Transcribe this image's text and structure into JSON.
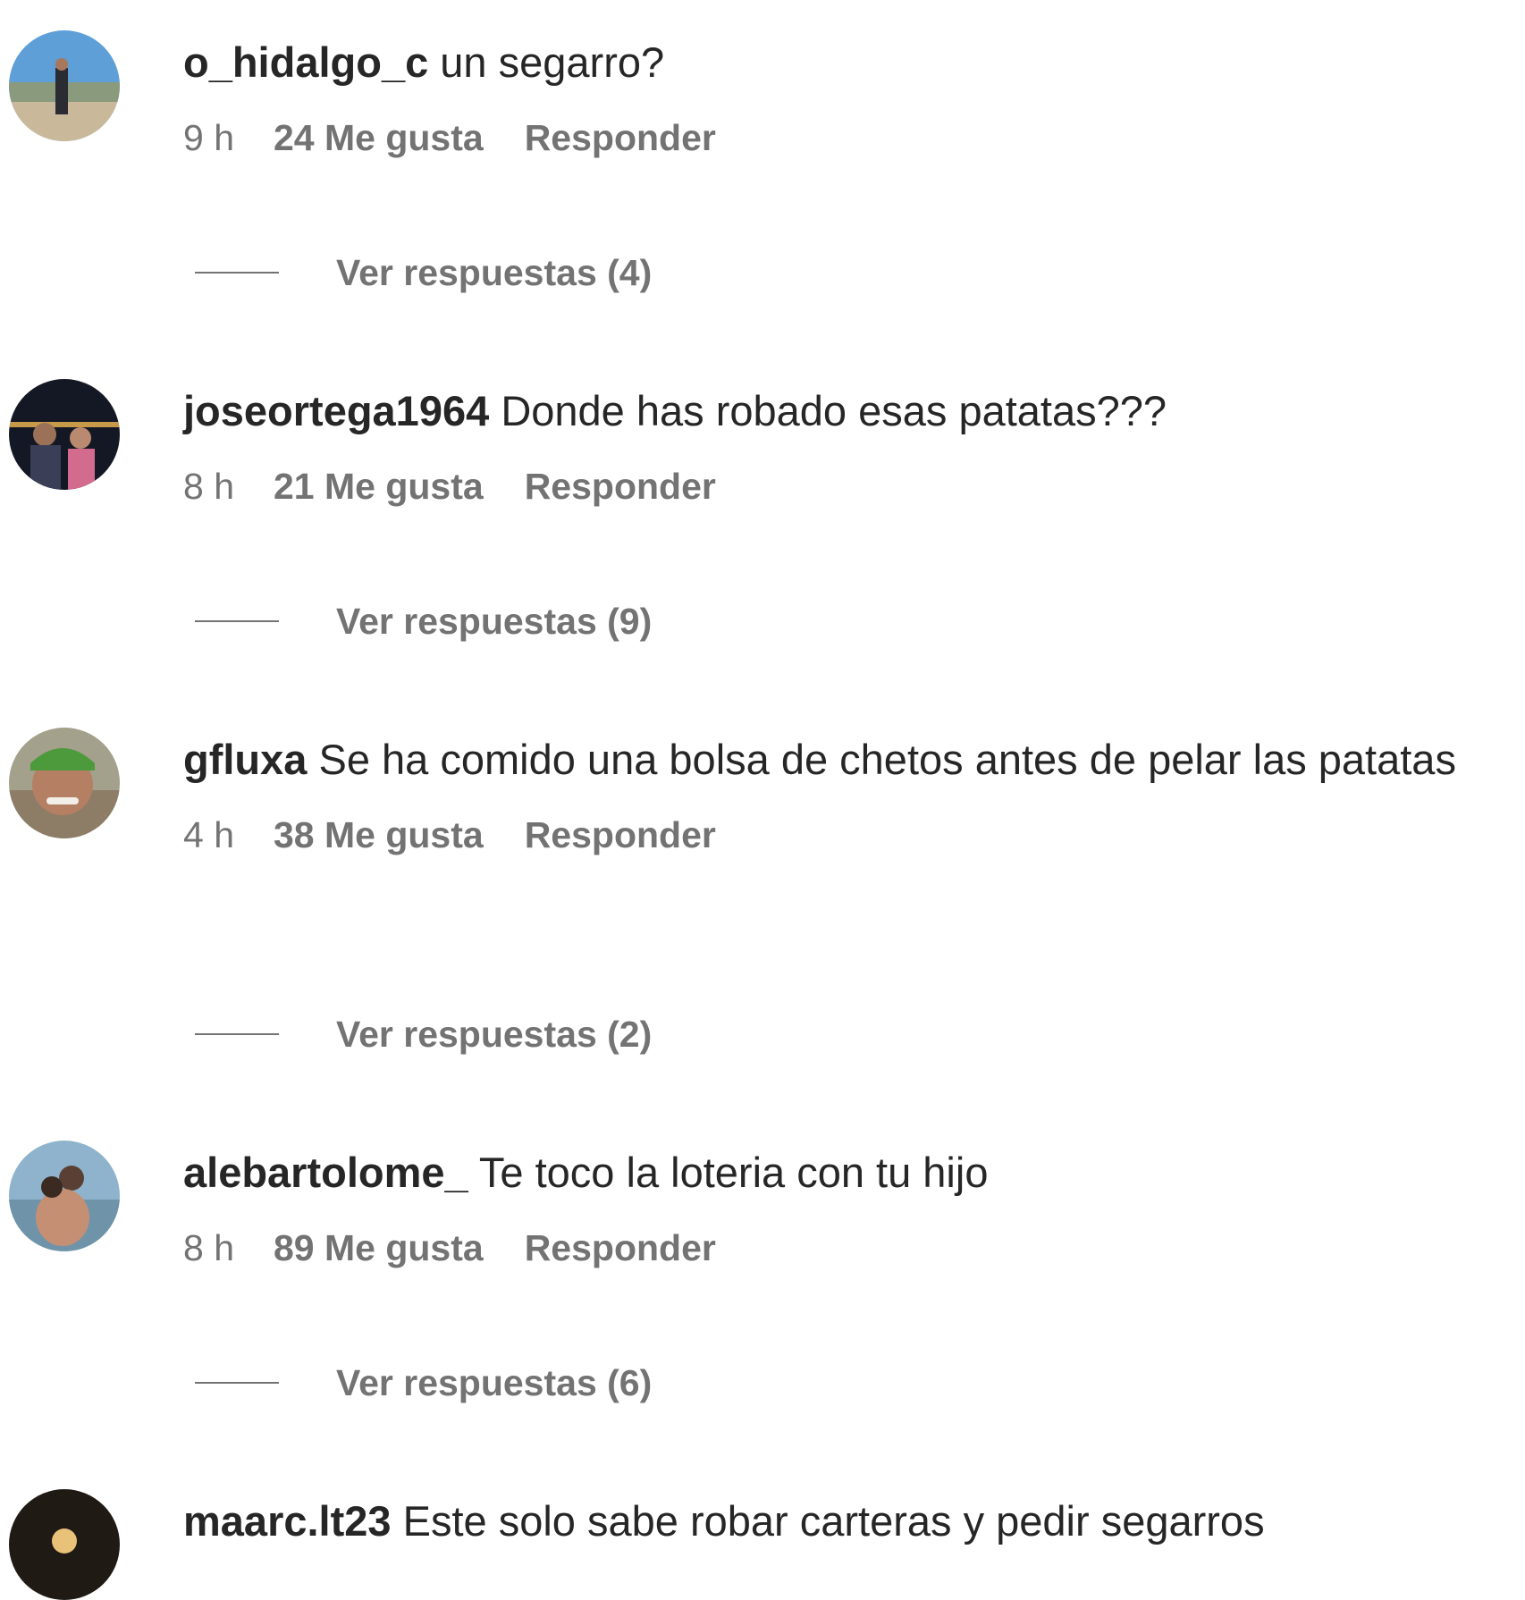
{
  "comments": [
    {
      "username": "o_hidalgo_c",
      "text": "un segarro?",
      "time": "9 h",
      "likes": "24 Me gusta",
      "reply": "Responder",
      "view_replies": "Ver respuestas (4)"
    },
    {
      "username": "joseortega1964",
      "text": "Donde has robado esas patatas???",
      "time": "8 h",
      "likes": "21 Me gusta",
      "reply": "Responder",
      "view_replies": "Ver respuestas (9)"
    },
    {
      "username": "gfluxa",
      "text": "Se ha comido una bolsa de chetos antes de pelar las patatas",
      "time": "4 h",
      "likes": "38 Me gusta",
      "reply": "Responder",
      "view_replies": "Ver respuestas (2)"
    },
    {
      "username": "alebartolome_",
      "text": "Te toco la loteria con tu hijo",
      "time": "8 h",
      "likes": "89 Me gusta",
      "reply": "Responder",
      "view_replies": "Ver respuestas (6)"
    },
    {
      "username": "maarc.lt23",
      "text": "Este solo sabe robar carteras y pedir segarros"
    }
  ],
  "colors": {
    "text": "#262626",
    "secondary": "#737373",
    "background": "#ffffff"
  }
}
